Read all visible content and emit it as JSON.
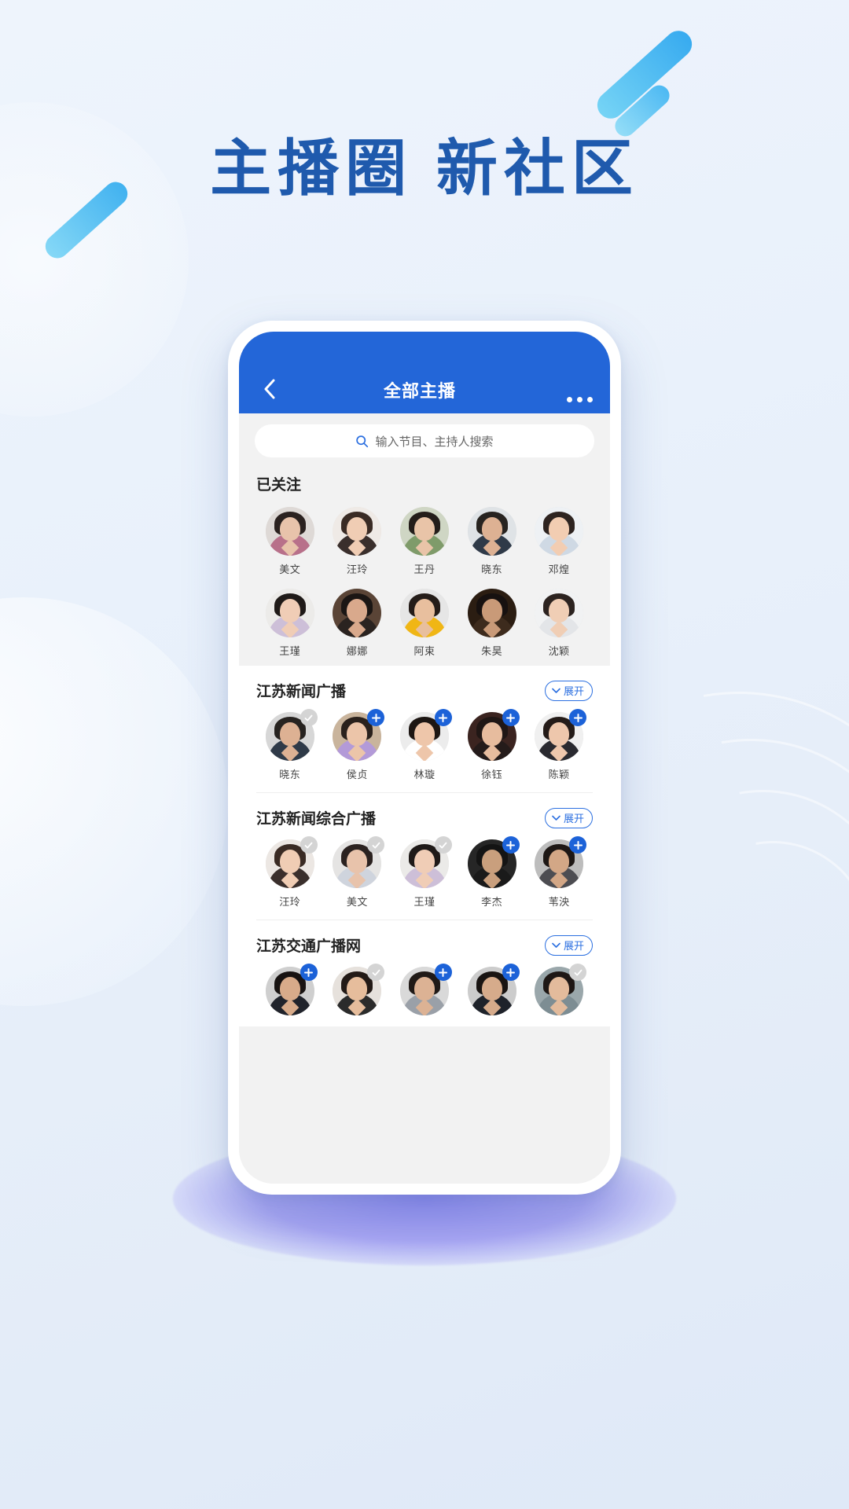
{
  "promo": {
    "headline": "主播圈 新社区"
  },
  "navbar": {
    "title": "全部主播",
    "back_icon": "chevron-left-icon",
    "more_icon": "more-dots-icon"
  },
  "search": {
    "placeholder": "输入节目、主持人搜索",
    "icon": "search-icon"
  },
  "followed": {
    "title": "已关注",
    "people": [
      {
        "name": "美文",
        "hair": "#2b2220",
        "skin": "#e8c3ab",
        "cloth": "#b8708a",
        "bg": "#ded9d6"
      },
      {
        "name": "汪玲",
        "hair": "#3a2b24",
        "skin": "#f0cdb4",
        "cloth": "#3a2f2c",
        "bg": "#efeae6"
      },
      {
        "name": "王丹",
        "hair": "#241d1a",
        "skin": "#e9c4a8",
        "cloth": "#7f9b6a",
        "bg": "#cfd6c4"
      },
      {
        "name": "晓东",
        "hair": "#272320",
        "skin": "#ddb193",
        "cloth": "#2f3a48",
        "bg": "#dfe3e6"
      },
      {
        "name": "邓煌",
        "hair": "#2e2420",
        "skin": "#f2cdb2",
        "cloth": "#cfd9e4",
        "bg": "#eef1f4"
      },
      {
        "name": "王瑾",
        "hair": "#1f1a18",
        "skin": "#f0cdb6",
        "cloth": "#cdbfd8",
        "bg": "#ecebe9"
      },
      {
        "name": "娜娜",
        "hair": "#1b1614",
        "skin": "#d9a98c",
        "cloth": "#2a2320",
        "bg": "#5a4436"
      },
      {
        "name": "阿束",
        "hair": "#241c18",
        "skin": "#e8bf9e",
        "cloth": "#f0b615",
        "bg": "#e6e6e6"
      },
      {
        "name": "朱昊",
        "hair": "#171110",
        "skin": "#c99a78",
        "cloth": "#3d2b1d",
        "bg": "#2b1d12"
      },
      {
        "name": "沈颖",
        "hair": "#2c2320",
        "skin": "#f0ceb5",
        "cloth": "#e3e5e8",
        "bg": "#f1f2f3"
      }
    ]
  },
  "stations": [
    {
      "name": "江苏新闻广播",
      "expand_label": "展开",
      "expand_icon": "chevron-down-icon",
      "people": [
        {
          "name": "晓东",
          "state": "followed",
          "badge_icon": "check-icon",
          "hair": "#272320",
          "skin": "#ddb193",
          "cloth": "#2f3a48",
          "bg": "#d7d7d7"
        },
        {
          "name": "侯贞",
          "state": "follow",
          "badge_icon": "plus-icon",
          "hair": "#2a211c",
          "skin": "#ecc5a9",
          "cloth": "#b39ad8",
          "bg": "#c9b49c"
        },
        {
          "name": "林璇",
          "state": "follow",
          "badge_icon": "plus-icon",
          "hair": "#1d1613",
          "skin": "#eec6aa",
          "cloth": "#ffffff",
          "bg": "#ececec"
        },
        {
          "name": "徐钰",
          "state": "follow",
          "badge_icon": "plus-icon",
          "hair": "#201715",
          "skin": "#e7bc9e",
          "cloth": "#241b1a",
          "bg": "#3b2420"
        },
        {
          "name": "陈颖",
          "state": "follow",
          "badge_icon": "plus-icon",
          "hair": "#241b18",
          "skin": "#eec7ac",
          "cloth": "#2a2a30",
          "bg": "#f0f0f0"
        }
      ]
    },
    {
      "name": "江苏新闻综合广播",
      "expand_label": "展开",
      "expand_icon": "chevron-down-icon",
      "people": [
        {
          "name": "汪玲",
          "state": "followed",
          "badge_icon": "check-icon",
          "hair": "#3a2b24",
          "skin": "#f0cdb4",
          "cloth": "#3a2f2c",
          "bg": "#ece7e3"
        },
        {
          "name": "美文",
          "state": "followed",
          "badge_icon": "check-icon",
          "hair": "#2b2220",
          "skin": "#e8c3ab",
          "cloth": "#cfd4dd",
          "bg": "#e5e4e3"
        },
        {
          "name": "王瑾",
          "state": "followed",
          "badge_icon": "check-icon",
          "hair": "#1f1a18",
          "skin": "#f0cdb6",
          "cloth": "#cdbfd8",
          "bg": "#ebeae8"
        },
        {
          "name": "李杰",
          "state": "follow",
          "badge_icon": "plus-icon",
          "hair": "#141414",
          "skin": "#c99f7d",
          "cloth": "#1a1a1a",
          "bg": "#262626"
        },
        {
          "name": "苇泱",
          "state": "follow",
          "badge_icon": "plus-icon",
          "hair": "#1d1715",
          "skin": "#d3a786",
          "cloth": "#4d4d52",
          "bg": "#bdbdbd"
        }
      ]
    },
    {
      "name": "江苏交通广播网",
      "expand_label": "展开",
      "expand_icon": "chevron-down-icon",
      "people": [
        {
          "name": "",
          "state": "follow",
          "badge_icon": "plus-icon",
          "hair": "#181312",
          "skin": "#d8ab8a",
          "cloth": "#20232b",
          "bg": "#cfcfcf"
        },
        {
          "name": "",
          "state": "followed",
          "badge_icon": "check-icon",
          "hair": "#231a16",
          "skin": "#e6bd9c",
          "cloth": "#2b2b2b",
          "bg": "#e6e1dc"
        },
        {
          "name": "",
          "state": "follow",
          "badge_icon": "plus-icon",
          "hair": "#201a17",
          "skin": "#dcb294",
          "cloth": "#9aa0a8",
          "bg": "#d9d9d9"
        },
        {
          "name": "",
          "state": "follow",
          "badge_icon": "plus-icon",
          "hair": "#191412",
          "skin": "#d6ab8b",
          "cloth": "#1e222a",
          "bg": "#cccccc"
        },
        {
          "name": "",
          "state": "followed",
          "badge_icon": "check-icon",
          "hair": "#1e1715",
          "skin": "#e3bb9c",
          "cloth": "#7d8d93",
          "bg": "#9aa7ab"
        }
      ]
    }
  ],
  "colors": {
    "brand_blue": "#2366d8",
    "headline_blue": "#1f5aad",
    "badge_add": "#1c62d8",
    "badge_done": "#d4d4d4"
  }
}
